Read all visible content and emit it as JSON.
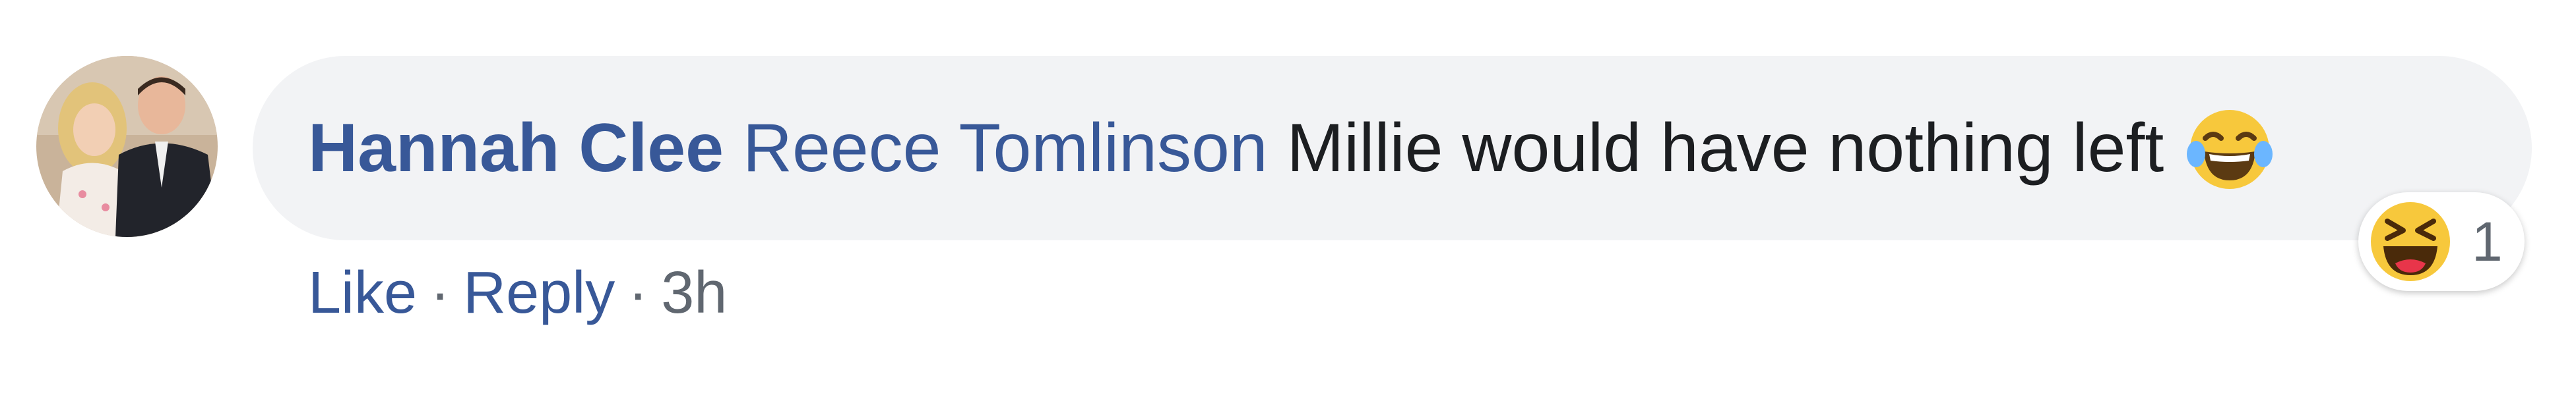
{
  "comment": {
    "author": "Hannah Clee",
    "mention": "Reece Tomlinson",
    "text": "Millie would have nothing left",
    "inline_emoji": "face-with-tears-of-joy-icon"
  },
  "reaction": {
    "icon": "haha-reaction-icon",
    "count": "1"
  },
  "actions": {
    "like_label": "Like",
    "reply_label": "Reply",
    "separator": "·",
    "timestamp": "3h"
  },
  "colors": {
    "link_blue": "#385898",
    "text_dark": "#1c1e21",
    "meta_gray": "#606770",
    "bubble_bg": "#f2f3f5",
    "emoji_yellow": "#f7c83c"
  }
}
